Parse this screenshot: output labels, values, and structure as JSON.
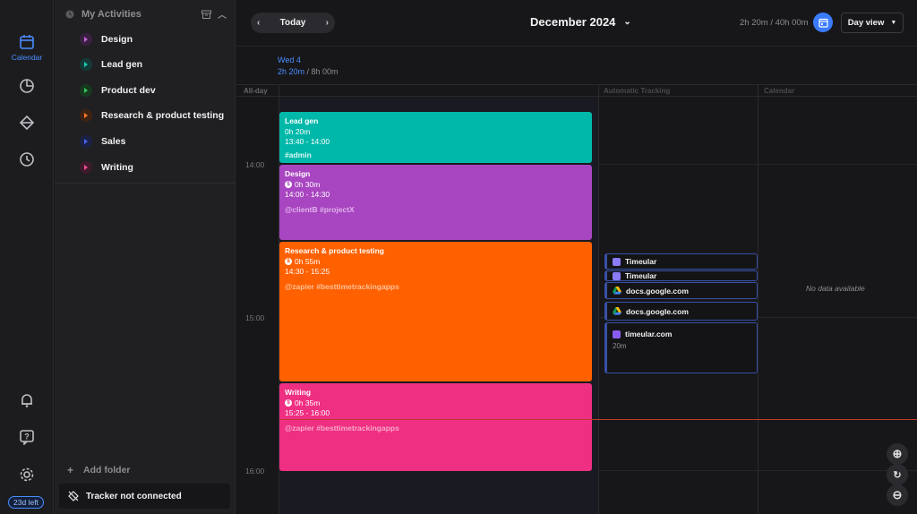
{
  "window": {
    "traffic_lights": [
      "#ff5f57",
      "#febc2e",
      "#28c840"
    ]
  },
  "rail": {
    "calendar_label": "Calendar",
    "trial_badge": "23d left"
  },
  "sidebar": {
    "header": "My Activities",
    "activities": [
      {
        "label": "Design",
        "color": "#a845c0"
      },
      {
        "label": "Lead gen",
        "color": "#00b8a9"
      },
      {
        "label": "Product dev",
        "color": "#2fb24a"
      },
      {
        "label": "Research & product testing",
        "color": "#ff6000"
      },
      {
        "label": "Sales",
        "color": "#3048d8"
      },
      {
        "label": "Writing",
        "color": "#ee2f82"
      }
    ],
    "add_folder": "Add folder",
    "tracker_status": "Tracker not connected"
  },
  "toolbar": {
    "today": "Today",
    "month": "December 2024",
    "hours": "2h 20m / 40h 00m",
    "view": "Day view"
  },
  "day": {
    "label": "Wed 4",
    "tracked": "2h 20m",
    "target": " / 8h 00m"
  },
  "columns": {
    "allday": "All-day",
    "automatic": "Automatic Tracking",
    "calendar": "Calendar"
  },
  "times": [
    "14:00",
    "15:00",
    "16:00"
  ],
  "events": [
    {
      "title": "Lead gen",
      "duration": "0h 20m",
      "range": "13:40 - 14:00",
      "tags": "#admin",
      "color": "#00b8a9",
      "tag_color": "#dff7f4",
      "billable": false
    },
    {
      "title": "Design",
      "duration": "0h 30m",
      "range": "14:00 - 14:30",
      "tags": "@clientB #projectX",
      "color": "#a845c0",
      "tag_color": "#e0b3ec",
      "billable": true
    },
    {
      "title": "Research & product testing",
      "duration": "0h 55m",
      "range": "14:30 - 15:25",
      "tags": "@zapier #besttimetrackingapps",
      "color": "#ff6000",
      "tag_color": "#ffc199",
      "billable": true
    },
    {
      "title": "Writing",
      "duration": "0h 35m",
      "range": "15:25 - 16:00",
      "tags": "@zapier #besttimetrackingapps",
      "color": "#ee2f82",
      "tag_color": "#f9a8cb",
      "billable": true
    }
  ],
  "tracking": [
    {
      "label": "Timeular",
      "icon": "timeular-icon"
    },
    {
      "label": "Timeular",
      "icon": "timeular-icon"
    },
    {
      "label": "docs.google.com",
      "icon": "google-drive-icon"
    },
    {
      "label": "docs.google.com",
      "icon": "google-drive-icon"
    },
    {
      "label": "timeular.com",
      "icon": "timeular-icon",
      "duration": "20m"
    }
  ],
  "calendar_empty": "No data available",
  "colors": {
    "accent": "#3b7cff",
    "now_line": "#c0392b"
  }
}
